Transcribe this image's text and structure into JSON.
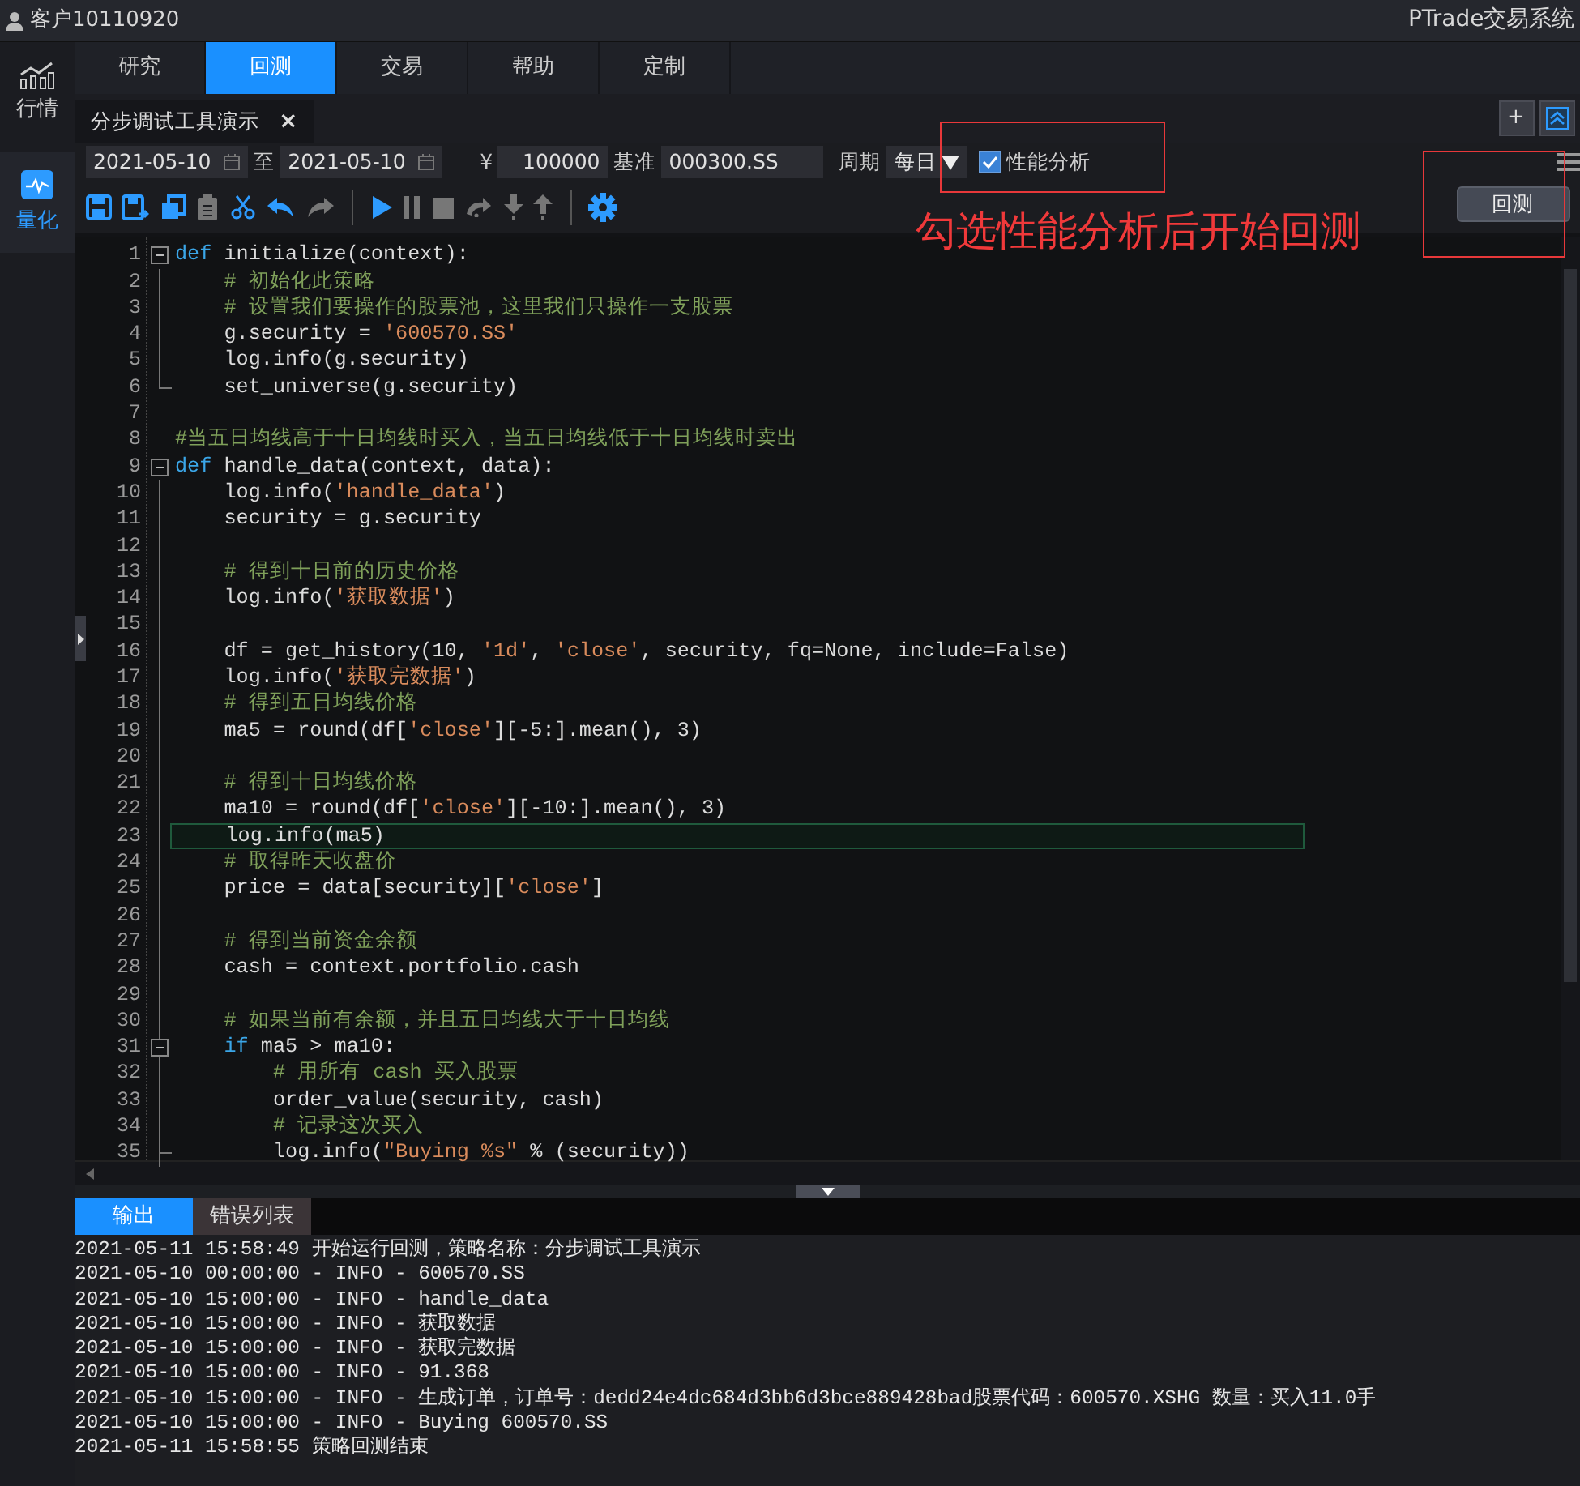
{
  "topbar": {
    "user": "客户10110920",
    "app_title": "PTrade交易系统"
  },
  "sidebar": [
    {
      "label": "行情",
      "selected": false
    },
    {
      "label": "量化",
      "selected": true
    }
  ],
  "nav_tabs": [
    {
      "label": "研究",
      "selected": false
    },
    {
      "label": "回测",
      "selected": true
    },
    {
      "label": "交易",
      "selected": false
    },
    {
      "label": "帮助",
      "selected": false
    },
    {
      "label": "定制",
      "selected": false
    }
  ],
  "doc_tabs": [
    {
      "label": "分步调试工具演示",
      "close": "×"
    }
  ],
  "doc_actions": [
    {
      "kind": "add",
      "label": "+"
    },
    {
      "kind": "collapse"
    }
  ],
  "params": {
    "start_date": "2021-05-10",
    "to_label": "至",
    "end_date": "2021-05-10",
    "currency": "¥",
    "capital": "100000",
    "benchmark_label": "基准",
    "benchmark": "000300.SS",
    "period_label": "周期",
    "period": "每日",
    "perf_label": "性能分析",
    "perf_checked": true
  },
  "toolbar": [
    {
      "kind": "save",
      "disabled": false
    },
    {
      "kind": "save-as",
      "disabled": false
    },
    {
      "kind": "copy",
      "disabled": false
    },
    {
      "kind": "paste",
      "disabled": true
    },
    {
      "kind": "cut",
      "disabled": false
    },
    {
      "kind": "undo",
      "disabled": false
    },
    {
      "kind": "redo",
      "disabled": true
    },
    {
      "kind": "sep"
    },
    {
      "kind": "play",
      "disabled": false
    },
    {
      "kind": "pause",
      "disabled": true
    },
    {
      "kind": "stop",
      "disabled": true
    },
    {
      "kind": "step-over",
      "disabled": true
    },
    {
      "kind": "step-into",
      "disabled": true
    },
    {
      "kind": "step-out",
      "disabled": true
    },
    {
      "kind": "sep"
    },
    {
      "kind": "settings",
      "disabled": false
    }
  ],
  "run_button": "回测",
  "annotation": {
    "text": "勾选性能分析后开始回测"
  },
  "code": [
    {
      "no": "1",
      "collapsible": true,
      "parts": [
        {
          "kind": "kw",
          "t": "def"
        },
        {
          "kind": "pl",
          "t": " initialize(context):"
        }
      ]
    },
    {
      "no": "2",
      "parts": [
        {
          "kind": "cm",
          "t": "    # 初始化此策略"
        }
      ]
    },
    {
      "no": "3",
      "parts": [
        {
          "kind": "cm",
          "t": "    # 设置我们要操作的股票池，这里我们只操作一支股票"
        }
      ]
    },
    {
      "no": "4",
      "parts": [
        {
          "kind": "pl",
          "t": "    g.security = "
        },
        {
          "kind": "str",
          "t": "'600570.SS'"
        }
      ]
    },
    {
      "no": "5",
      "parts": [
        {
          "kind": "pl",
          "t": "    log.info(g.security)"
        }
      ]
    },
    {
      "no": "6",
      "block_end": true,
      "parts": [
        {
          "kind": "pl",
          "t": "    set_universe(g.security)"
        }
      ]
    },
    {
      "no": "7"
    },
    {
      "no": "8",
      "parts": [
        {
          "kind": "cm",
          "t": "#当五日均线高于十日均线时买入，当五日均线低于十日均线时卖出"
        }
      ]
    },
    {
      "no": "9",
      "collapsible": true,
      "parts": [
        {
          "kind": "kw",
          "t": "def"
        },
        {
          "kind": "pl",
          "t": " handle_data(context, data):"
        }
      ]
    },
    {
      "no": "10",
      "parts": [
        {
          "kind": "pl",
          "t": "    log.info("
        },
        {
          "kind": "str",
          "t": "'handle_data'"
        },
        {
          "kind": "pl",
          "t": ")"
        }
      ]
    },
    {
      "no": "11",
      "parts": [
        {
          "kind": "pl",
          "t": "    security = g.security"
        }
      ]
    },
    {
      "no": "12"
    },
    {
      "no": "13",
      "parts": [
        {
          "kind": "cm",
          "t": "    # 得到十日前的历史价格"
        }
      ]
    },
    {
      "no": "14",
      "parts": [
        {
          "kind": "pl",
          "t": "    log.info("
        },
        {
          "kind": "str",
          "t": "'获取数据'"
        },
        {
          "kind": "pl",
          "t": ")"
        }
      ]
    },
    {
      "no": "15"
    },
    {
      "no": "16",
      "parts": [
        {
          "kind": "pl",
          "t": "    df = get_history(10, "
        },
        {
          "kind": "str",
          "t": "'1d'"
        },
        {
          "kind": "pl",
          "t": ", "
        },
        {
          "kind": "str",
          "t": "'close'"
        },
        {
          "kind": "pl",
          "t": ", security, fq=None, include=False)"
        }
      ]
    },
    {
      "no": "17",
      "parts": [
        {
          "kind": "pl",
          "t": "    log.info("
        },
        {
          "kind": "str",
          "t": "'获取完数据'"
        },
        {
          "kind": "pl",
          "t": ")"
        }
      ]
    },
    {
      "no": "18",
      "parts": [
        {
          "kind": "cm",
          "t": "    # 得到五日均线价格"
        }
      ]
    },
    {
      "no": "19",
      "parts": [
        {
          "kind": "pl",
          "t": "    ma5 = round(df["
        },
        {
          "kind": "str",
          "t": "'close'"
        },
        {
          "kind": "pl",
          "t": "][-5:].mean(), 3)"
        }
      ]
    },
    {
      "no": "20"
    },
    {
      "no": "21",
      "parts": [
        {
          "kind": "cm",
          "t": "    # 得到十日均线价格"
        }
      ]
    },
    {
      "no": "22",
      "parts": [
        {
          "kind": "pl",
          "t": "    ma10 = round(df["
        },
        {
          "kind": "str",
          "t": "'close'"
        },
        {
          "kind": "pl",
          "t": "][-10:].mean(), 3)"
        }
      ]
    },
    {
      "no": "23",
      "current": true,
      "parts": [
        {
          "kind": "pl",
          "t": "    log.info(ma5)"
        }
      ]
    },
    {
      "no": "24",
      "parts": [
        {
          "kind": "cm",
          "t": "    # 取得昨天收盘价"
        }
      ]
    },
    {
      "no": "25",
      "parts": [
        {
          "kind": "pl",
          "t": "    price = data[security]["
        },
        {
          "kind": "str",
          "t": "'close'"
        },
        {
          "kind": "pl",
          "t": "]"
        }
      ]
    },
    {
      "no": "26"
    },
    {
      "no": "27",
      "parts": [
        {
          "kind": "cm",
          "t": "    # 得到当前资金余额"
        }
      ]
    },
    {
      "no": "28",
      "parts": [
        {
          "kind": "pl",
          "t": "    cash = context.portfolio.cash"
        }
      ]
    },
    {
      "no": "29"
    },
    {
      "no": "30",
      "parts": [
        {
          "kind": "cm",
          "t": "    # 如果当前有余额，并且五日均线大于十日均线"
        }
      ]
    },
    {
      "no": "31",
      "collapsible": true,
      "parts": [
        {
          "kind": "kw",
          "t": "    if"
        },
        {
          "kind": "pl",
          "t": " ma5 > ma10:"
        }
      ]
    },
    {
      "no": "32",
      "parts": [
        {
          "kind": "cm",
          "t": "        # 用所有 cash 买入股票"
        }
      ]
    },
    {
      "no": "33",
      "parts": [
        {
          "kind": "pl",
          "t": "        order_value(security, cash)"
        }
      ]
    },
    {
      "no": "34",
      "parts": [
        {
          "kind": "cm",
          "t": "        # 记录这次买入"
        }
      ]
    },
    {
      "no": "35",
      "block_end": true,
      "parts": [
        {
          "kind": "pl",
          "t": "        log.info("
        },
        {
          "kind": "str",
          "t": "\"Buying %s\""
        },
        {
          "kind": "pl",
          "t": " % (security))"
        }
      ]
    }
  ],
  "output_tabs": [
    {
      "label": "输出",
      "selected": true
    },
    {
      "label": "错误列表",
      "selected": false
    }
  ],
  "log": [
    "2021-05-11 15:58:49 开始运行回测，策略名称：分步调试工具演示",
    "2021-05-10 00:00:00 - INFO - 600570.SS",
    "2021-05-10 15:00:00 - INFO - handle_data",
    "2021-05-10 15:00:00 - INFO - 获取数据",
    "2021-05-10 15:00:00 - INFO - 获取完数据",
    "2021-05-10 15:00:00 - INFO - 91.368",
    "2021-05-10 15:00:00 - INFO - 生成订单，订单号：dedd24e4dc684d3bb6d3bce889428bad股票代码：600570.XSHG 数量：买入11.0手",
    "2021-05-10 15:00:00 - INFO - Buying 600570.SS",
    "2021-05-11 15:58:55 策略回测结束"
  ]
}
